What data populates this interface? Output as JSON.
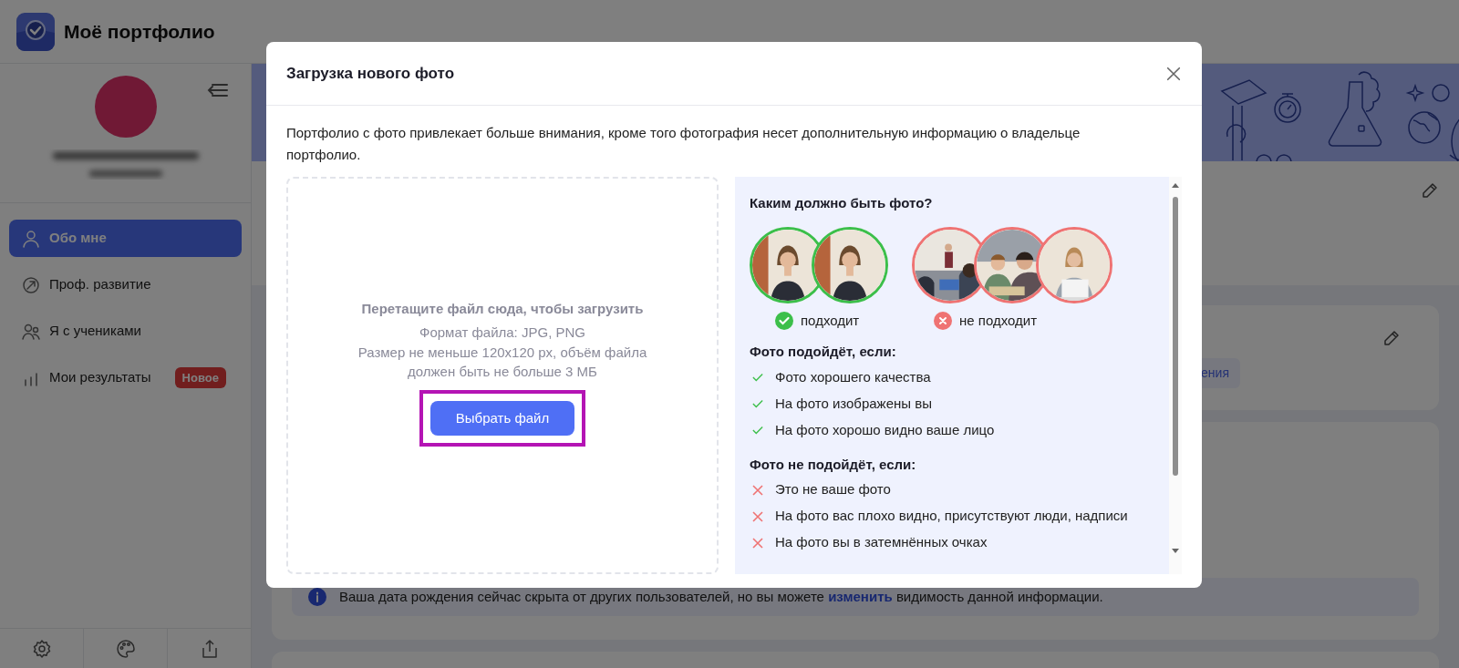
{
  "app": {
    "title": "Моё портфолио"
  },
  "sidebar": {
    "nav": [
      {
        "label": "Обо мне",
        "kind": "person",
        "selected": true
      },
      {
        "label": "Проф. развитие",
        "kind": "growth",
        "selected": false
      },
      {
        "label": "Я с учениками",
        "kind": "students",
        "selected": false
      },
      {
        "label": "Мои результаты",
        "kind": "results",
        "selected": false,
        "badge": "Новое"
      }
    ]
  },
  "main": {
    "chip": "ения",
    "info_alert": {
      "before": "Ваша дата рождения сейчас скрыта от других пользователей, но вы можете ",
      "link": "изменить",
      "after": " видимость данной информации."
    }
  },
  "modal": {
    "title": "Загрузка нового фото",
    "description": "Портфолио с фото привлекает больше внимания, кроме того фотография несет дополнительную информацию о владельце портфолио.",
    "dropzone": {
      "heading": "Перетащите файл сюда, чтобы загрузить",
      "format": "Формат файла: JPG, PNG",
      "size": "Размер не меньше 120x120 px, объём файла должен быть не больше 3 МБ",
      "button": {
        "label": "Выбрать файл",
        "highlighted": true
      }
    },
    "guide": {
      "title": "Каким должно быть фото?",
      "groups": [
        {
          "kind": "good",
          "label": "подходит"
        },
        {
          "kind": "bad",
          "label": "не подходит"
        }
      ],
      "rules": [
        {
          "kind": "good",
          "heading": "Фото подойдёт, если:",
          "items": [
            "Фото хорошего качества",
            "На фото изображены вы",
            "На фото хорошо видно ваше лицо"
          ]
        },
        {
          "kind": "bad",
          "heading": "Фото не подойдёт, если:",
          "items": [
            "Это не ваше фото",
            "На фото вас плохо видно, присутствуют люди, надписи",
            "На фото вы в затемнённых очках"
          ]
        }
      ]
    }
  }
}
